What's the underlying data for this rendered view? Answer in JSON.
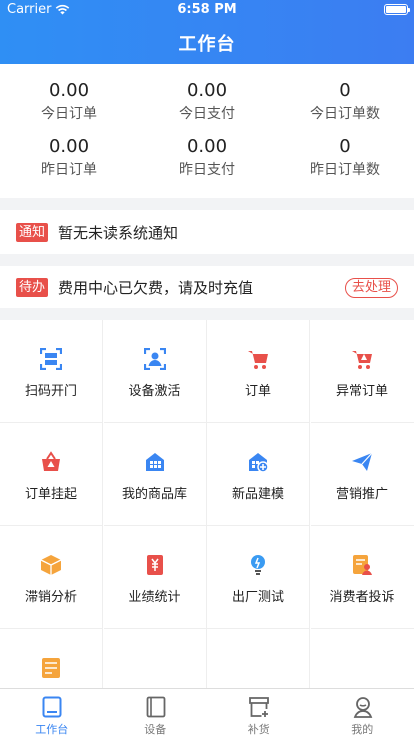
{
  "status": {
    "carrier": "Carrier",
    "time": "6:58 PM"
  },
  "header": {
    "title": "工作台"
  },
  "stats": [
    {
      "value": "0.00",
      "label": "今日订单"
    },
    {
      "value": "0.00",
      "label": "今日支付"
    },
    {
      "value": "0",
      "label": "今日订单数"
    },
    {
      "value": "0.00",
      "label": "昨日订单"
    },
    {
      "value": "0.00",
      "label": "昨日支付"
    },
    {
      "value": "0",
      "label": "昨日订单数"
    }
  ],
  "notice": {
    "tag": "通知",
    "text": "暂无未读系统通知"
  },
  "todo": {
    "tag": "待办",
    "text": "费用中心已欠费，请及时充值",
    "action": "去处理"
  },
  "grid": [
    {
      "label": "扫码开门",
      "icon": "scan-icon"
    },
    {
      "label": "设备激活",
      "icon": "device-activate-icon"
    },
    {
      "label": "订单",
      "icon": "cart-icon"
    },
    {
      "label": "异常订单",
      "icon": "cart-warning-icon"
    },
    {
      "label": "订单挂起",
      "icon": "basket-warning-icon"
    },
    {
      "label": "我的商品库",
      "icon": "store-icon"
    },
    {
      "label": "新品建模",
      "icon": "store-add-icon"
    },
    {
      "label": "营销推广",
      "icon": "paper-plane-icon"
    },
    {
      "label": "滞销分析",
      "icon": "box-icon"
    },
    {
      "label": "业绩统计",
      "icon": "yen-icon"
    },
    {
      "label": "出厂测试",
      "icon": "bulb-icon"
    },
    {
      "label": "消费者投诉",
      "icon": "complaint-icon"
    },
    {
      "label": "",
      "icon": "list-icon"
    }
  ],
  "colors": {
    "primary": "#3a86f2",
    "alert": "#e8504a",
    "orange": "#f5a43c"
  },
  "tabbar": [
    {
      "label": "工作台",
      "icon": "workbench-icon",
      "active": true
    },
    {
      "label": "设备",
      "icon": "device-icon",
      "active": false
    },
    {
      "label": "补货",
      "icon": "restock-icon",
      "active": false
    },
    {
      "label": "我的",
      "icon": "profile-icon",
      "active": false
    }
  ]
}
